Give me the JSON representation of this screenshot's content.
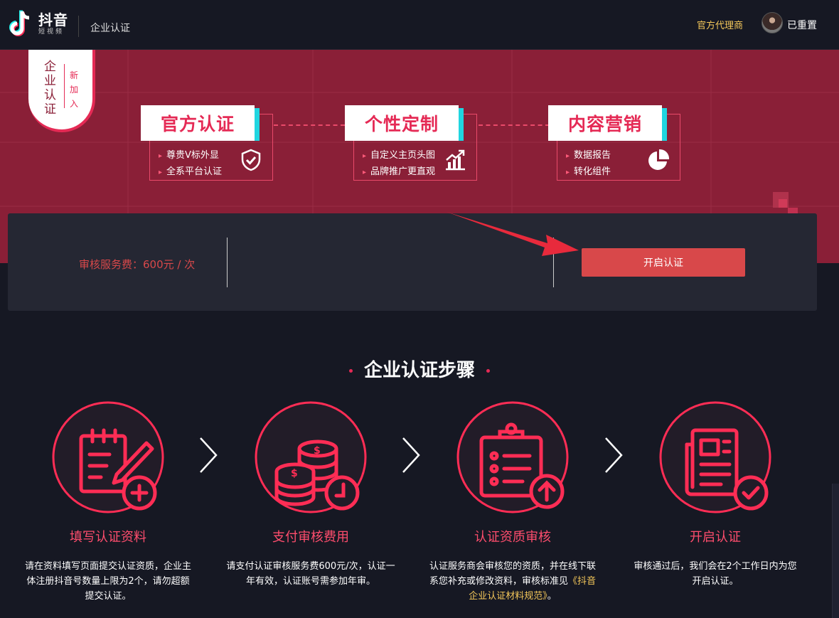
{
  "header": {
    "logo_name": "抖音",
    "logo_sub": "短视频",
    "section_title": "企业认证",
    "agent_link": "官方代理商",
    "username": "已重置"
  },
  "banner": {
    "tag_main": "企业认证",
    "tag_sub": "新加入",
    "features": [
      {
        "title": "官方认证",
        "items": [
          "尊贵V标外显",
          "全系平台认证"
        ],
        "icon": "shield-check-icon"
      },
      {
        "title": "个性定制",
        "items": [
          "自定义主页头图",
          "品牌推广更直观"
        ],
        "icon": "growth-chart-icon"
      },
      {
        "title": "内容营销",
        "items": [
          "数据报告",
          "转化组件"
        ],
        "icon": "pie-chart-icon"
      }
    ]
  },
  "pricing": {
    "fee_text": "审核服务费：600元 / 次",
    "button_label": "开启认证"
  },
  "steps": {
    "title": "企业认证步骤",
    "items": [
      {
        "name": "填写认证资料",
        "desc": "请在资料填写页面提交认证资质，企业主体注册抖音号数量上限为2个，请勿超额提交认证。",
        "icon": "form-edit-icon"
      },
      {
        "name": "支付审核费用",
        "desc": "请支付认证审核服务费600元/次，认证一年有效，认证账号需参加年审。",
        "icon": "coins-payment-icon"
      },
      {
        "name": "认证资质审核",
        "desc_before": "认证服务商会审核您的资质，并在线下联系您补充或修改资料，审核标准见",
        "link": "《抖音企业认证材料规范》",
        "desc_after": "。",
        "icon": "clipboard-upload-icon"
      },
      {
        "name": "开启认证",
        "desc": "审核通过后，我们会在2个工作日内为您开启认证。",
        "icon": "document-check-icon"
      }
    ]
  },
  "colors": {
    "accent": "#e52a55",
    "banner_bg": "#8a1f37",
    "button": "#d8484a",
    "link": "#f5c85a",
    "page_bg": "#161823"
  }
}
